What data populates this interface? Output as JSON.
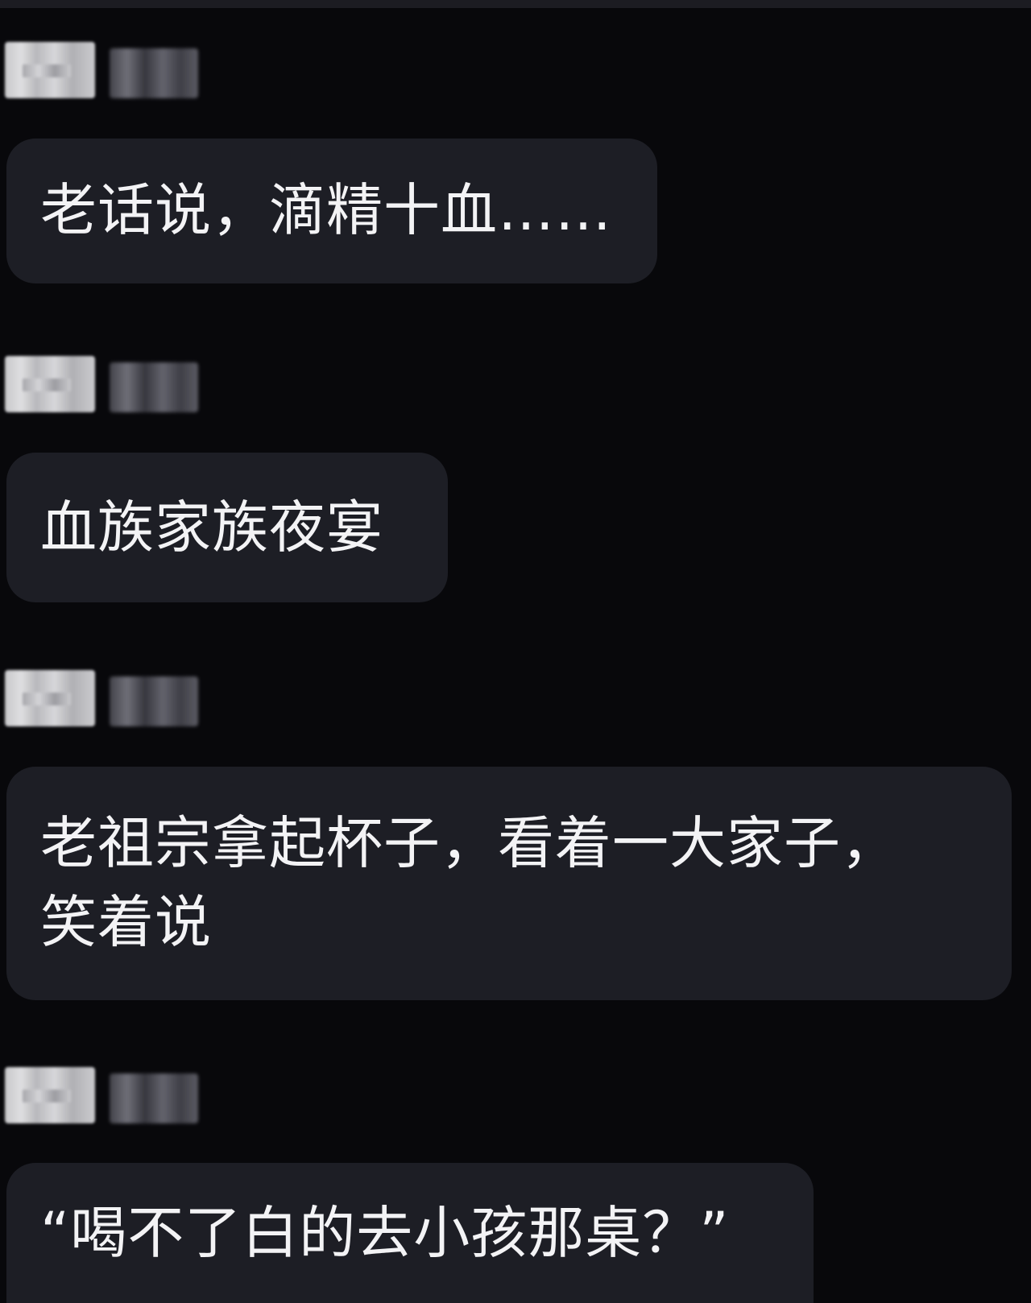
{
  "messages": [
    {
      "text": "老话说，滴精十血……"
    },
    {
      "text": "血族家族夜宴"
    },
    {
      "text": "老祖宗拿起杯子，看着一大家子，\n笑着说"
    },
    {
      "text": "“喝不了白的去小孩那桌？”"
    }
  ],
  "colors": {
    "background": "#08080b",
    "bubble": "#1d1e25",
    "text": "#f3f3f5"
  }
}
